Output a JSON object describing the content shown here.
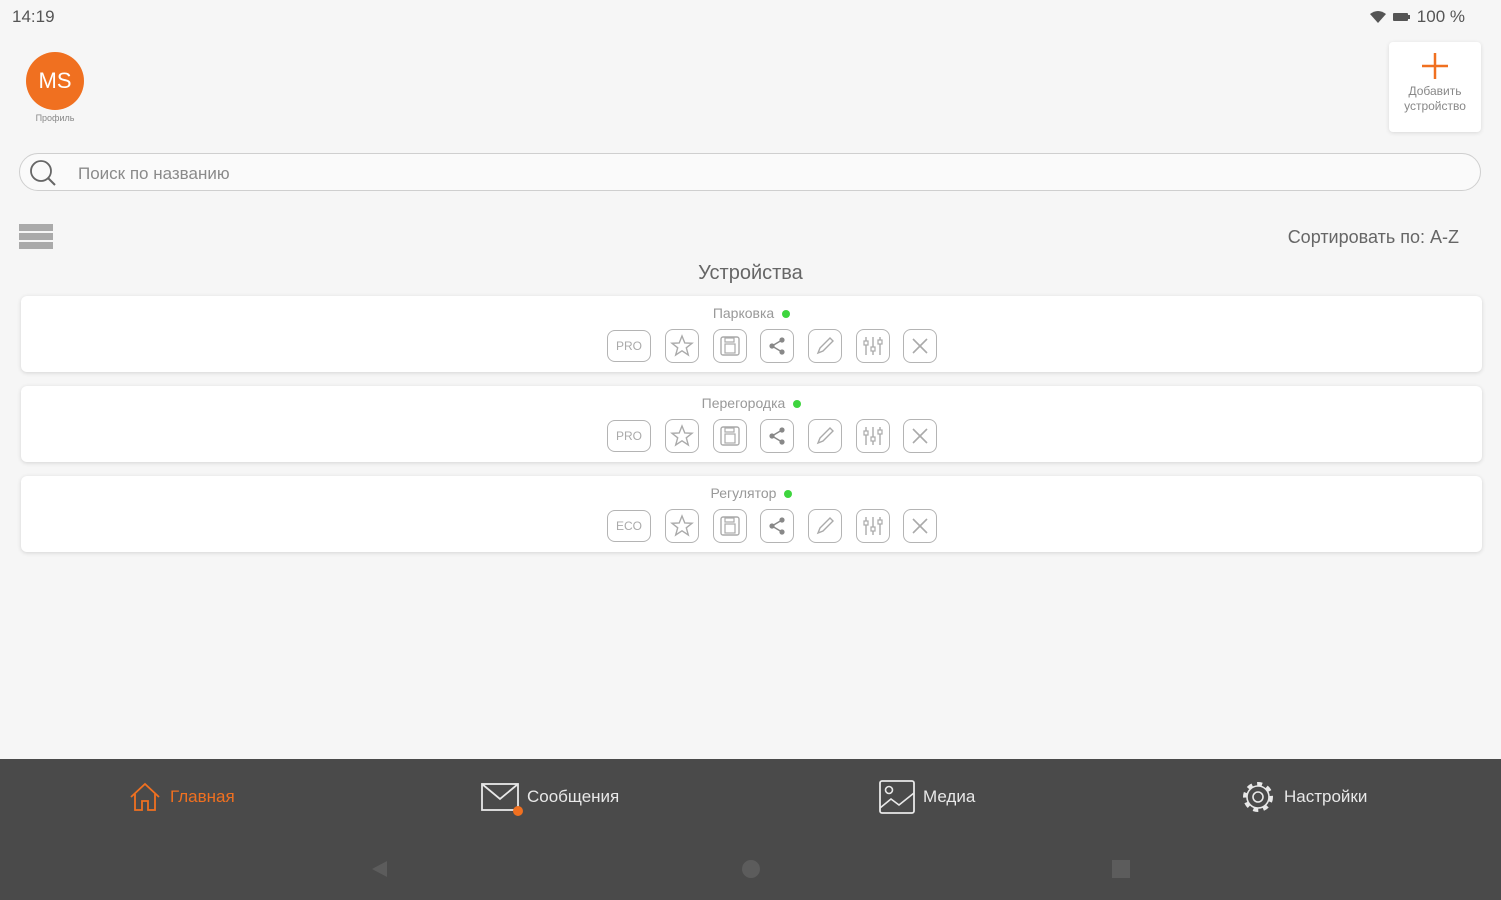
{
  "status": {
    "time": "14:19",
    "battery": "100 %"
  },
  "profile": {
    "initials": "MS",
    "caption": "Профиль"
  },
  "add_device": {
    "label": "Добавить устройство"
  },
  "search": {
    "placeholder": "Поиск по названию"
  },
  "sort": {
    "label": "Сортировать по: A-Z"
  },
  "section_title": "Устройства",
  "devices": [
    {
      "name": "Парковка",
      "badge": "PRO",
      "online": true
    },
    {
      "name": "Перегородка",
      "badge": "PRO",
      "online": true
    },
    {
      "name": "Регулятор",
      "badge": "ECO",
      "online": true
    }
  ],
  "nav": {
    "home": "Главная",
    "messages": "Сообщения",
    "media": "Медиа",
    "settings": "Настройки"
  },
  "colors": {
    "accent": "#f07020",
    "online": "#3ed53e",
    "bar": "#4a4a4a"
  }
}
